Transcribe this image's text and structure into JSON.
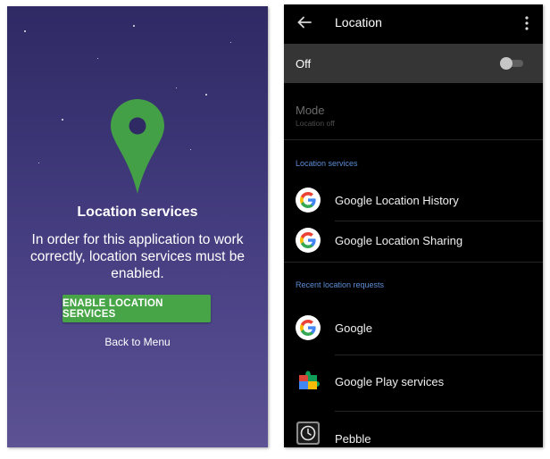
{
  "left_screen": {
    "title": "Location services",
    "message": "In order for this application to work correctly, location services must be enabled.",
    "enable_button": "ENABLE LOCATION SERVICES",
    "back_link": "Back to Menu",
    "colors": {
      "background_top": "#2f2a64",
      "background_bottom": "#5c5294",
      "pin": "#43a046",
      "button": "#47a547"
    },
    "icons": {
      "pin": "map-pin-icon"
    }
  },
  "right_screen": {
    "app_bar": {
      "title": "Location",
      "back_icon": "arrow-left-icon",
      "menu_icon": "more-vert-icon"
    },
    "toggle": {
      "label": "Off",
      "state": "off"
    },
    "mode": {
      "title": "Mode",
      "subtitle": "Location off"
    },
    "sections": [
      {
        "header": "Location services",
        "items": [
          {
            "label": "Google Location History",
            "icon": "google-g-icon"
          },
          {
            "label": "Google Location Sharing",
            "icon": "google-g-icon"
          }
        ]
      },
      {
        "header": "Recent location requests",
        "items": [
          {
            "label": "Google",
            "icon": "google-g-icon"
          },
          {
            "label": "Google Play services",
            "icon": "google-play-services-icon"
          },
          {
            "label": "Pebble",
            "icon": "pebble-watch-icon"
          }
        ]
      }
    ],
    "colors": {
      "background": "#000000",
      "toggle_row": "#353535",
      "section_header": "#5b8ed6"
    }
  }
}
